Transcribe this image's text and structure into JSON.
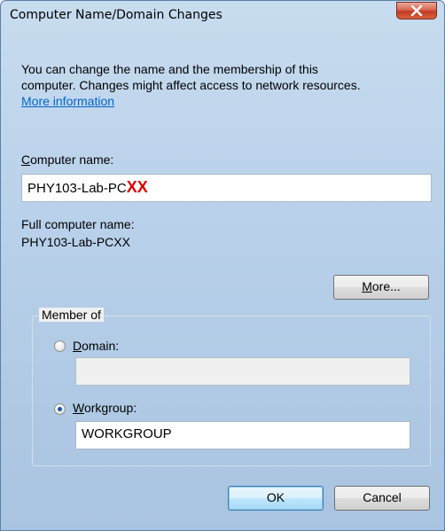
{
  "window": {
    "title": "Computer Name/Domain Changes"
  },
  "intro": {
    "line1": "You can change the name and the membership of this",
    "line2": "computer. Changes might affect access to network resources.",
    "link": "More information"
  },
  "computer_name": {
    "label_accel": "C",
    "label_rest": "omputer name:",
    "value_prefix": "PHY103-Lab-PC",
    "value_marker": "XX"
  },
  "full_name": {
    "label": "Full computer name:",
    "value": "PHY103-Lab-PCXX"
  },
  "more_button": {
    "accel": "M",
    "rest": "ore..."
  },
  "member_of": {
    "label": "Member of",
    "domain": {
      "accel": "D",
      "rest": "omain:",
      "selected": false,
      "value": ""
    },
    "workgroup": {
      "accel": "W",
      "rest": "orkgroup:",
      "selected": true,
      "value": "WORKGROUP"
    }
  },
  "buttons": {
    "ok": "OK",
    "cancel": "Cancel"
  }
}
